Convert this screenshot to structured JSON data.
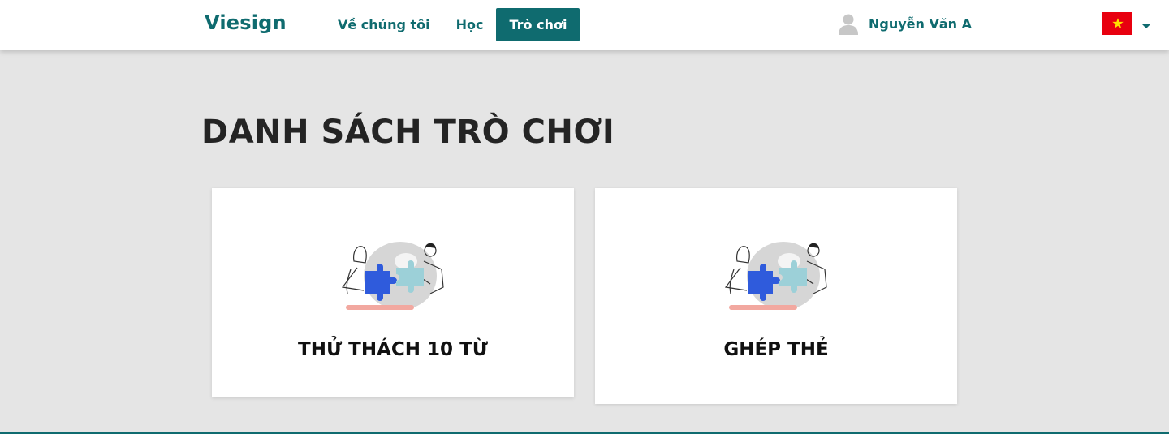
{
  "header": {
    "logo": "Viesign",
    "nav": [
      {
        "label": "Về chúng tôi",
        "active": false
      },
      {
        "label": "Học",
        "active": false
      },
      {
        "label": "Trò chơi",
        "active": true
      }
    ],
    "user": {
      "name": "Nguyễn Văn A",
      "avatar_icon": "user-avatar-icon"
    },
    "language": {
      "flag_icon": "vietnam-flag-icon",
      "dropdown_icon": "caret-down-icon"
    }
  },
  "main": {
    "title": "DANH SÁCH TRÒ CHƠI",
    "games": [
      {
        "label": "THỬ THÁCH 10 TỪ",
        "illustration": "puzzle-collaboration-illustration"
      },
      {
        "label": "GHÉP THẺ",
        "illustration": "puzzle-collaboration-illustration"
      }
    ]
  },
  "colors": {
    "brand": "#0f6b6f",
    "background": "#e5e5e5",
    "card": "#ffffff",
    "flag_red": "#e8000f",
    "flag_star": "#ffde00"
  }
}
